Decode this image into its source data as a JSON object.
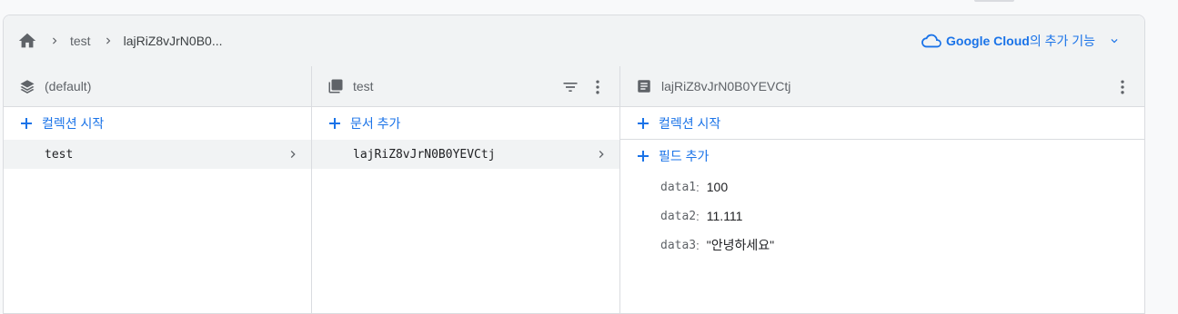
{
  "breadcrumb": {
    "home_icon": "home-icon",
    "items": [
      "test",
      "lajRiZ8vJrN0B0..."
    ]
  },
  "google_cloud": {
    "brand": "Google Cloud",
    "suffix": "의 추가 기능",
    "icon": "cloud-icon"
  },
  "columns": {
    "database": {
      "title": "(default)",
      "icon": "database-stack-icon",
      "add_label": "컬렉션 시작",
      "items": [
        "test"
      ]
    },
    "collection": {
      "title": "test",
      "icon": "collection-icon",
      "add_label": "문서 추가",
      "items": [
        "lajRiZ8vJrN0B0YEVCtj"
      ]
    },
    "document": {
      "title": "lajRiZ8vJrN0B0YEVCtj",
      "icon": "document-icon",
      "add_collection_label": "컬렉션 시작",
      "add_field_label": "필드 추가",
      "fields": [
        {
          "key": "data1",
          "value": "100"
        },
        {
          "key": "data2",
          "value": "11.111"
        },
        {
          "key": "data3",
          "value": "\"안녕하세요\""
        }
      ]
    }
  },
  "colors": {
    "accent": "#1a73e8",
    "header_bg": "#f1f3f4",
    "border": "#dadce0"
  }
}
